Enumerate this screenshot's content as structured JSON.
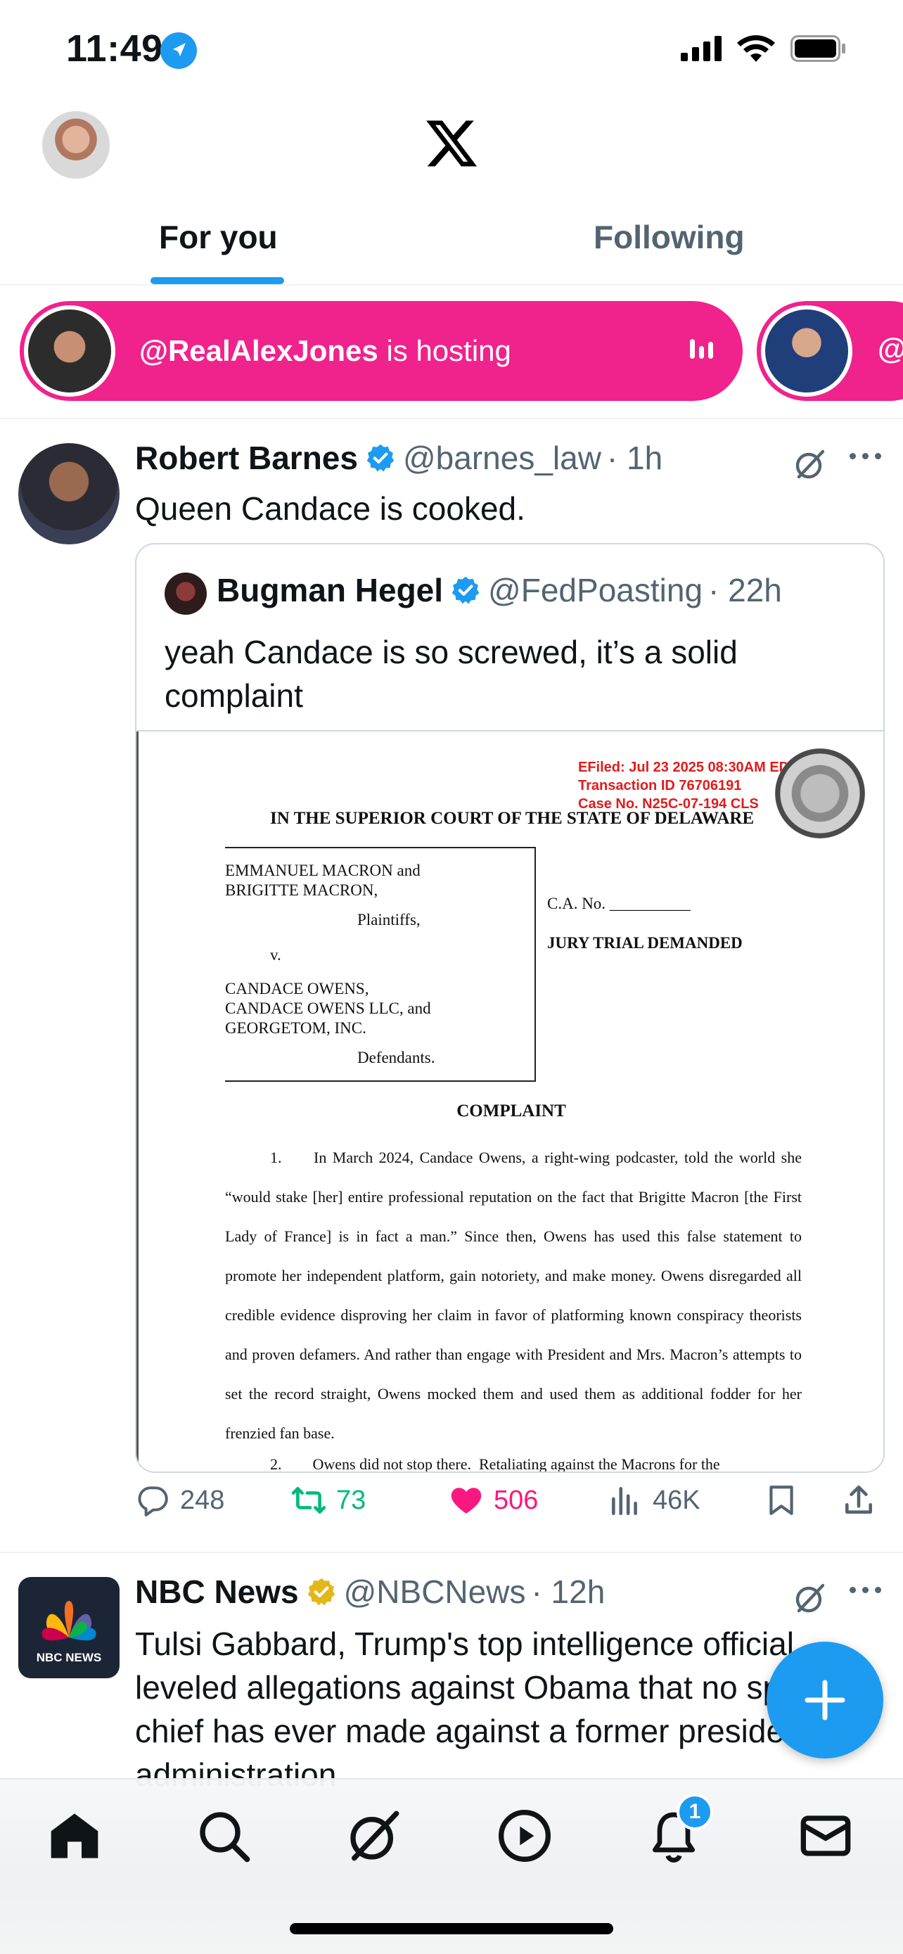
{
  "status_bar": {
    "time": "11:49"
  },
  "header": {
    "tabs": [
      "For you",
      "Following"
    ],
    "active_tab": "For you"
  },
  "spaces": {
    "host": "@RealAlexJones",
    "hosting_text": "is hosting",
    "second_pill_text": "@"
  },
  "tweet1": {
    "name": "Robert Barnes",
    "handle": "@barnes_law",
    "time": "· 1h",
    "text": "Queen Candace is cooked.",
    "quote": {
      "name": "Bugman Hegel",
      "handle": "@FedPoasting",
      "time": "· 22h",
      "text": "yeah Candace is so screwed, it’s a solid complaint",
      "document": {
        "efiled": [
          "EFiled:  Jul 23 2025 08:30AM EDT",
          "Transaction ID 76706191",
          "Case No. N25C-07-194 CLS"
        ],
        "court": "IN THE SUPERIOR COURT OF THE STATE OF DELAWARE",
        "plaintiffs_names": "EMMANUEL MACRON and\nBRIGITTE MACRON,",
        "plaintiffs_label": "Plaintiffs,",
        "versus": "v.",
        "defendants_names": "CANDACE OWENS,\nCANDACE OWENS LLC, and\nGEORGETOM, INC.",
        "defendants_label": "Defendants.",
        "ca_no": "C.A. No. __________",
        "jury": "JURY TRIAL DEMANDED",
        "title": "COMPLAINT",
        "para_num": "1.",
        "para_text": "In March 2024, Candace Owens, a right-wing podcaster, told the world she “would stake [her] entire professional reputation on the fact that Brigitte Macron [the First Lady of France] is in fact a man.”  Since then, Owens has used this false statement to promote her independent platform, gain notoriety, and make money. Owens disregarded all credible evidence disproving her claim in favor of platforming known conspiracy theorists and proven defamers.  And rather than engage with President and Mrs. Macron’s attempts to set the record straight, Owens mocked them and used them as additional fodder for her frenzied fan base.",
        "para2": "2.        Owens did not stop there.  Retaliating against the Macrons for the"
      }
    },
    "stats": {
      "replies": "248",
      "reposts": "73",
      "likes": "506",
      "views": "46K"
    }
  },
  "tweet2": {
    "name": "NBC News",
    "handle": "@NBCNews",
    "time": "· 12h",
    "avatar_text": "NBC NEWS",
    "text": "Tulsi Gabbard, Trump's top intelligence official leveled allegations against Obama that no spy chief has ever made against a former president or administration"
  },
  "bottom_nav": {
    "notification_count": "1"
  },
  "colors": {
    "accent": "#1d9bf0",
    "spaces_pink": "#f0228c",
    "repost_green": "#00ba7c",
    "like_pink": "#f91880",
    "efiled_red": "#e21b1b"
  },
  "icons": [
    "location-arrow-icon",
    "signal-icon",
    "wifi-icon",
    "battery-icon",
    "x-logo",
    "verified-badge-icon",
    "grok-icon",
    "more-icon",
    "reply-icon",
    "repost-icon",
    "like-icon",
    "views-icon",
    "bookmark-icon",
    "share-icon",
    "compose-icon",
    "home-icon",
    "search-icon",
    "grok-nav-icon",
    "video-icon",
    "bell-icon",
    "mail-icon"
  ]
}
